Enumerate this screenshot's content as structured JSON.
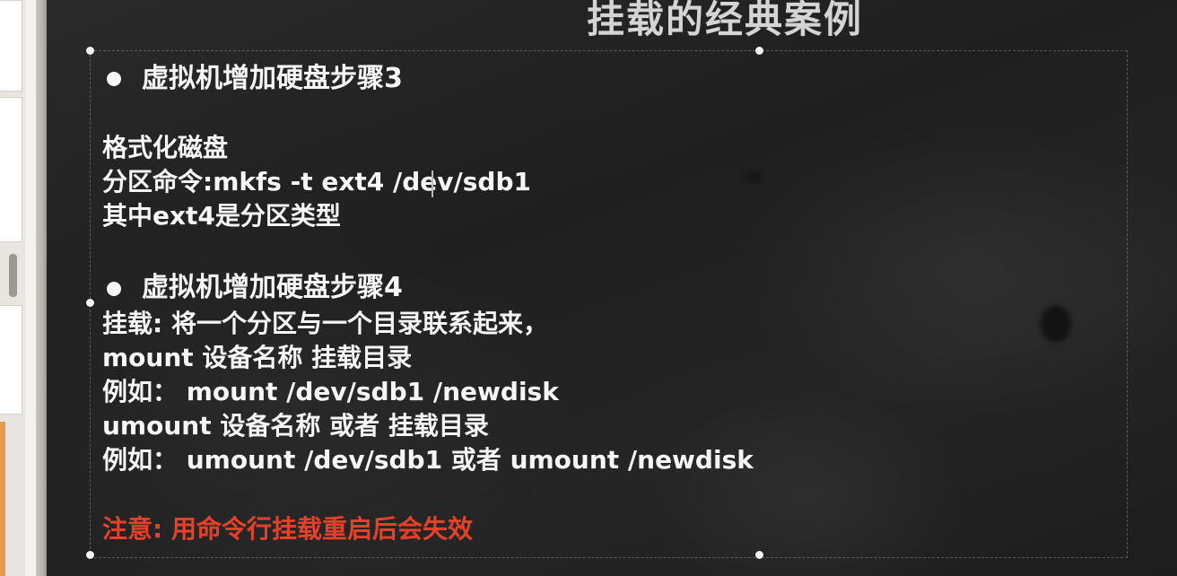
{
  "slide": {
    "title": "挂载的经典案例",
    "step3": {
      "heading": "虚拟机增加硬盘步骤3",
      "lines": [
        "格式化磁盘",
        "分区命令:mkfs -t  ext4   /dev/sdb1",
        "其中ext4是分区类型"
      ]
    },
    "step4": {
      "heading": "虚拟机增加硬盘步骤4",
      "lines": [
        "挂载: 将一个分区与一个目录联系起来，",
        "mount     设备名称  挂载目录",
        "例如： mount     /dev/sdb1     /newdisk",
        "umount    设备名称 或者    挂载目录",
        "例如：  umount    /dev/sdb1 或者 umount    /newdisk"
      ]
    },
    "note": "注意: 用命令行挂载重启后会失效"
  },
  "colors": {
    "board": "#222222",
    "text": "#f6f6f6",
    "warning": "#e5412a",
    "title": "#d4d4d4"
  }
}
